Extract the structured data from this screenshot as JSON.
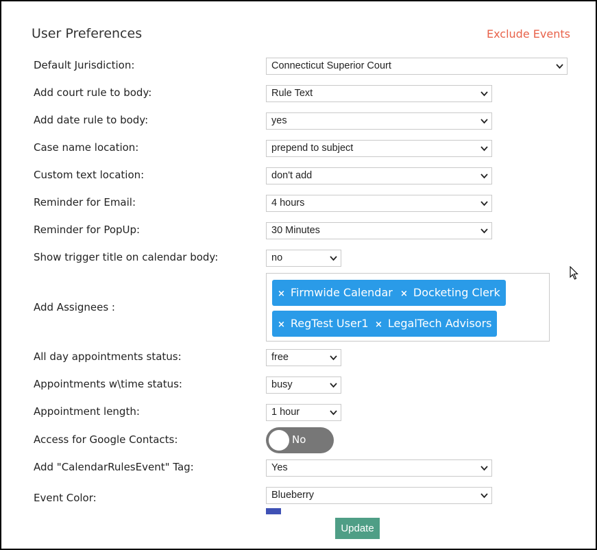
{
  "header": {
    "title": "User Preferences",
    "exclude_link": "Exclude Events"
  },
  "rows": [
    {
      "label": "Default Jurisdiction:",
      "value": "Connecticut Superior Court"
    },
    {
      "label": "Add court rule to body:",
      "value": "Rule Text"
    },
    {
      "label": "Add date rule to body:",
      "value": "yes"
    },
    {
      "label": "Case name location:",
      "value": "prepend to subject"
    },
    {
      "label": "Custom text location:",
      "value": "don't add"
    },
    {
      "label": "Reminder for Email:",
      "value": "4 hours"
    },
    {
      "label": "Reminder for PopUp:",
      "value": "30 Minutes"
    },
    {
      "label": "Show trigger title on calendar body:",
      "value": "no"
    },
    {
      "label": "Add Assignees :"
    },
    {
      "label": "All day appointments status:",
      "value": "free"
    },
    {
      "label": "Appointments w\\time status:",
      "value": "busy"
    },
    {
      "label": "Appointment length:",
      "value": "1 hour"
    },
    {
      "label": "Access for Google Contacts:"
    },
    {
      "label": "Add \"CalendarRulesEvent\" Tag:",
      "value": "Yes"
    },
    {
      "label": "Event Color:",
      "value": "Blueberry"
    }
  ],
  "assignees": {
    "remove_glyph": "×",
    "tags": [
      "Firmwide Calendar",
      "Docketing Clerk",
      "RegTest User1",
      "LegalTech Advisors"
    ]
  },
  "google_contacts_toggle": {
    "state": "No",
    "on": false
  },
  "event_color_swatch": "#3f51b5",
  "update_button": "Update",
  "colors": {
    "accent_link": "#e8624a",
    "tag_bg": "#2a9be8",
    "update_bg": "#4f9e86",
    "toggle_bg": "#777777"
  }
}
